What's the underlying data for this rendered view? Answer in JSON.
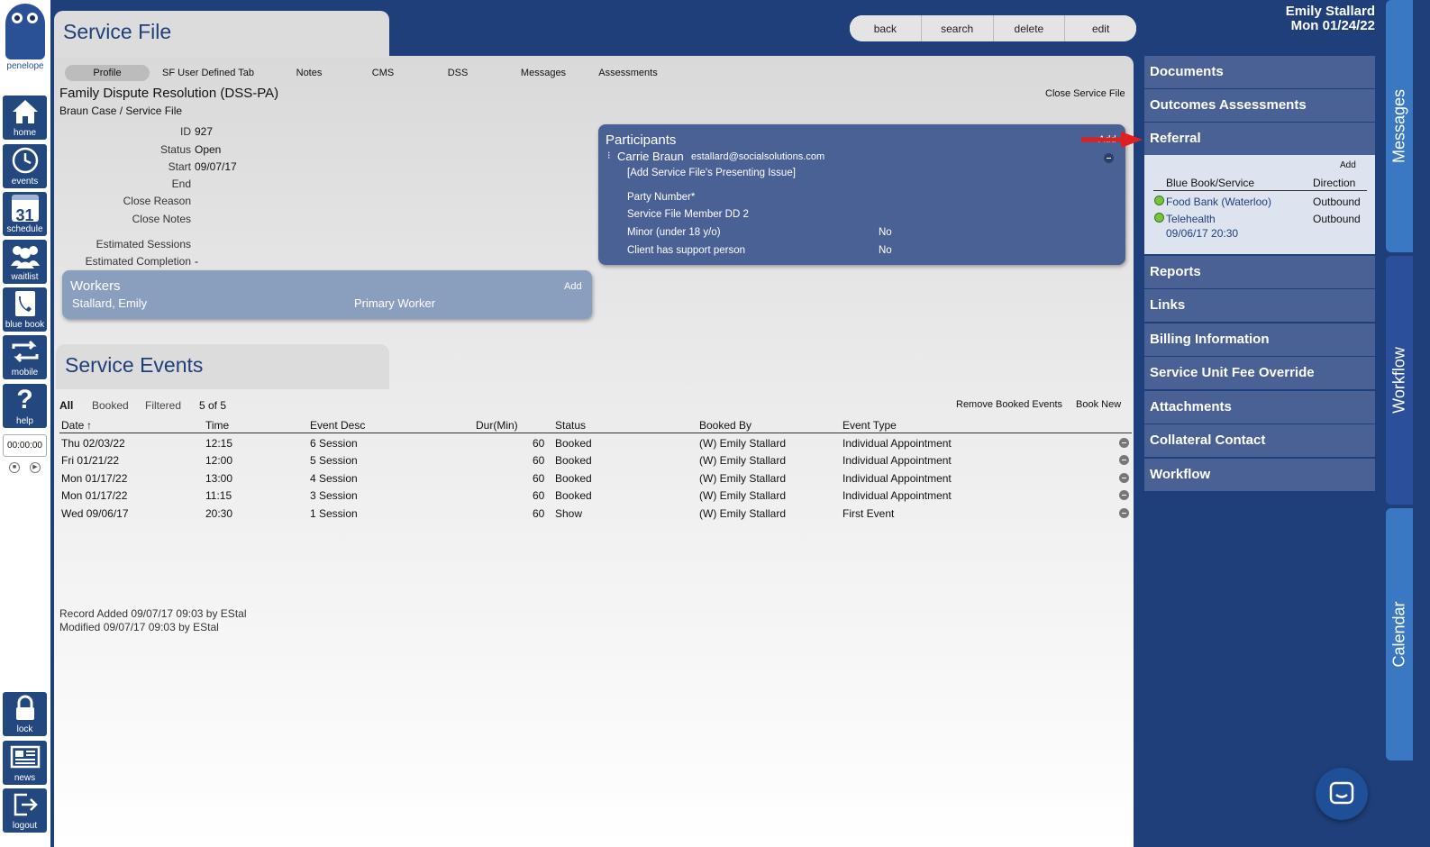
{
  "app": {
    "logo_text": "penelope"
  },
  "nav": [
    {
      "key": "home",
      "label": "home"
    },
    {
      "key": "events",
      "label": "events"
    },
    {
      "key": "schedule",
      "label": "schedule",
      "day": "31"
    },
    {
      "key": "waitlist",
      "label": "waitlist"
    },
    {
      "key": "bluebook",
      "label": "blue book"
    },
    {
      "key": "mobile",
      "label": "mobile"
    },
    {
      "key": "help",
      "label": "help"
    },
    {
      "key": "lock",
      "label": "lock"
    },
    {
      "key": "news",
      "label": "news"
    },
    {
      "key": "logout",
      "label": "logout"
    }
  ],
  "timer": "00:00:00",
  "user": {
    "name": "Emily Stallard",
    "date": "Mon 01/24/22"
  },
  "service_file": {
    "title": "Service File",
    "actions": [
      "back",
      "search",
      "delete",
      "edit"
    ],
    "tabs": [
      "Profile",
      "SF User Defined Tab",
      "Notes",
      "CMS",
      "DSS",
      "Messages",
      "Assessments"
    ],
    "name": "Family Dispute Resolution (DSS-PA)",
    "subtitle": "Braun Case / Service File",
    "close_link": "Close Service File",
    "fields": {
      "id_label": "ID",
      "id_value": "927",
      "status_label": "Status",
      "status_value": "Open",
      "start_label": "Start",
      "start_value": "09/07/17",
      "end_label": "End",
      "close_reason_label": "Close Reason",
      "close_notes_label": "Close Notes",
      "est_sessions_label": "Estimated Sessions",
      "est_completion_label": "Estimated Completion",
      "est_completion_value": "-"
    }
  },
  "participants": {
    "title": "Participants",
    "add_label": "Add",
    "name": "Carrie Braun",
    "email": "estallard@socialsolutions.com",
    "presenting_issue": "[Add Service File's Presenting Issue]",
    "party_number": "Party Number*",
    "member": "Service File Member DD 2",
    "minor_label": "Minor (under 18 y/o)",
    "minor_value": "No",
    "support_label": "Client has support person",
    "support_value": "No"
  },
  "workers": {
    "title": "Workers",
    "add_label": "Add",
    "name": "Stallard, Emily",
    "role": "Primary Worker"
  },
  "service_events": {
    "title": "Service Events",
    "filters": [
      "All",
      "Booked",
      "Filtered"
    ],
    "count": "5 of 5",
    "remove_label": "Remove Booked Events",
    "book_new_label": "Book New",
    "columns": [
      "Date",
      "Time",
      "Event Desc",
      "Dur(Min)",
      "Status",
      "Booked By",
      "Event Type"
    ],
    "sort_indicator": "↑",
    "rows": [
      {
        "date": "Thu 02/03/22",
        "time": "12:15",
        "desc": "6 Session",
        "dur": "60",
        "status": "Booked",
        "by": "(W) Emily Stallard",
        "type": "Individual Appointment"
      },
      {
        "date": "Fri 01/21/22",
        "time": "12:00",
        "desc": "5 Session",
        "dur": "60",
        "status": "Booked",
        "by": "(W) Emily Stallard",
        "type": "Individual Appointment"
      },
      {
        "date": "Mon 01/17/22",
        "time": "13:00",
        "desc": "4 Session",
        "dur": "60",
        "status": "Booked",
        "by": "(W) Emily Stallard",
        "type": "Individual Appointment"
      },
      {
        "date": "Mon 01/17/22",
        "time": "11:15",
        "desc": "3 Session",
        "dur": "60",
        "status": "Booked",
        "by": "(W) Emily Stallard",
        "type": "Individual Appointment"
      },
      {
        "date": "Wed 09/06/17",
        "time": "20:30",
        "desc": "1 Session",
        "dur": "60",
        "status": "Show",
        "by": "(W) Emily Stallard",
        "type": "First Event"
      }
    ],
    "record_added": "Record Added 09/07/17 09:03 by EStal",
    "modified": "Modified 09/07/17 09:03 by EStal"
  },
  "right_panel": {
    "items": [
      "Documents",
      "Outcomes Assessments",
      "Referral",
      "Reports",
      "Links",
      "Billing Information",
      "Service Unit Fee Override",
      "Attachments",
      "Collateral Contact",
      "Workflow"
    ],
    "referral": {
      "add_label": "Add",
      "col_service": "Blue Book/Service",
      "col_direction": "Direction",
      "rows": [
        {
          "service": "Food Bank (Waterloo)",
          "direction": "Outbound",
          "date": ""
        },
        {
          "service": "Telehealth",
          "direction": "Outbound",
          "date": "09/06/17 20:30"
        }
      ]
    }
  },
  "side_tabs": [
    "Messages",
    "Workflow",
    "Calendar"
  ],
  "colors": {
    "nav": "#23477f",
    "panel_blue": "#4a6196",
    "accent_red": "#e02020"
  }
}
